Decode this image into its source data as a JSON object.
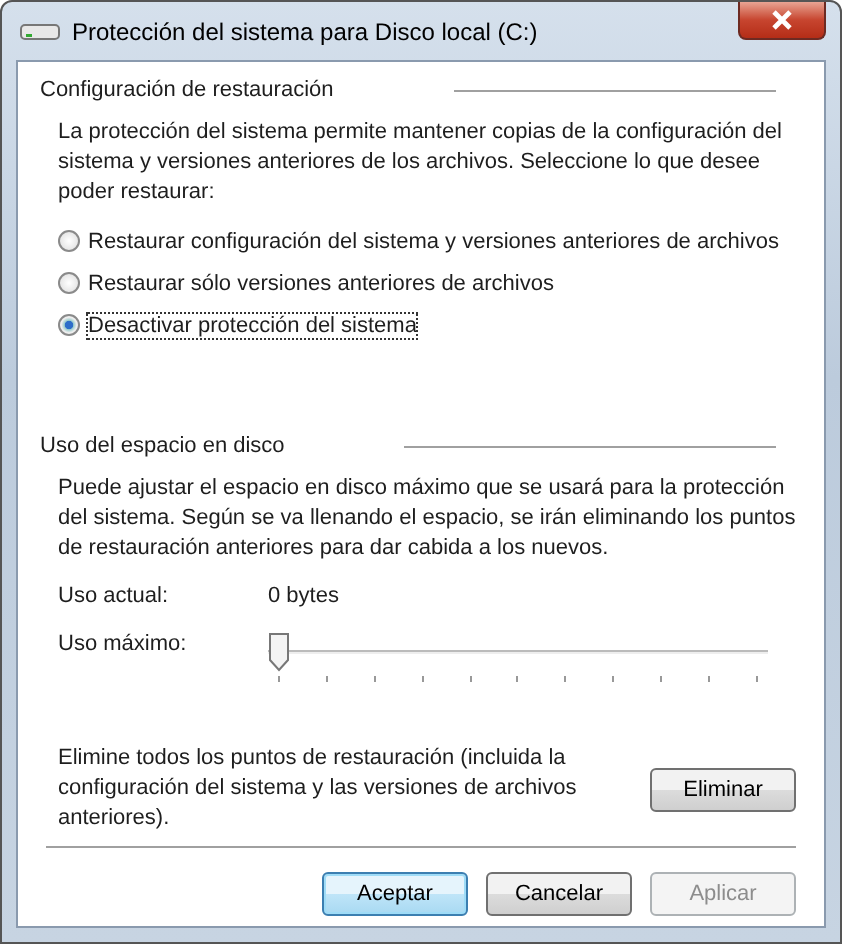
{
  "window": {
    "title": "Protección del sistema para Disco local (C:)"
  },
  "restore_settings": {
    "heading": "Configuración de restauración",
    "description": "La protección del sistema permite mantener copias de la configuración del sistema y versiones anteriores de los archivos. Seleccione lo que desee poder restaurar:",
    "options": [
      {
        "label": "Restaurar configuración del sistema y versiones anteriores de archivos",
        "selected": false
      },
      {
        "label": "Restaurar sólo versiones anteriores de archivos",
        "selected": false
      },
      {
        "label": "Desactivar protección del sistema",
        "selected": true
      }
    ]
  },
  "disk_usage": {
    "heading": "Uso del espacio en disco",
    "description": "Puede ajustar el espacio en disco máximo que se usará para la protección del sistema. Según se va llenando el espacio, se irán eliminando los puntos de restauración anteriores para dar cabida a los nuevos.",
    "current_label": "Uso actual:",
    "current_value": "0 bytes",
    "max_label": "Uso máximo:",
    "max_slider": {
      "level": 0
    }
  },
  "delete": {
    "description": "Elimine todos los puntos de restauración (incluida la configuración del sistema y las versiones de archivos anteriores).",
    "button": "Eliminar"
  },
  "buttons": [
    {
      "label": "Aceptar",
      "default": true,
      "disabled": false
    },
    {
      "label": "Cancelar",
      "default": false,
      "disabled": false
    },
    {
      "label": "Aplicar",
      "default": false,
      "disabled": true
    }
  ]
}
